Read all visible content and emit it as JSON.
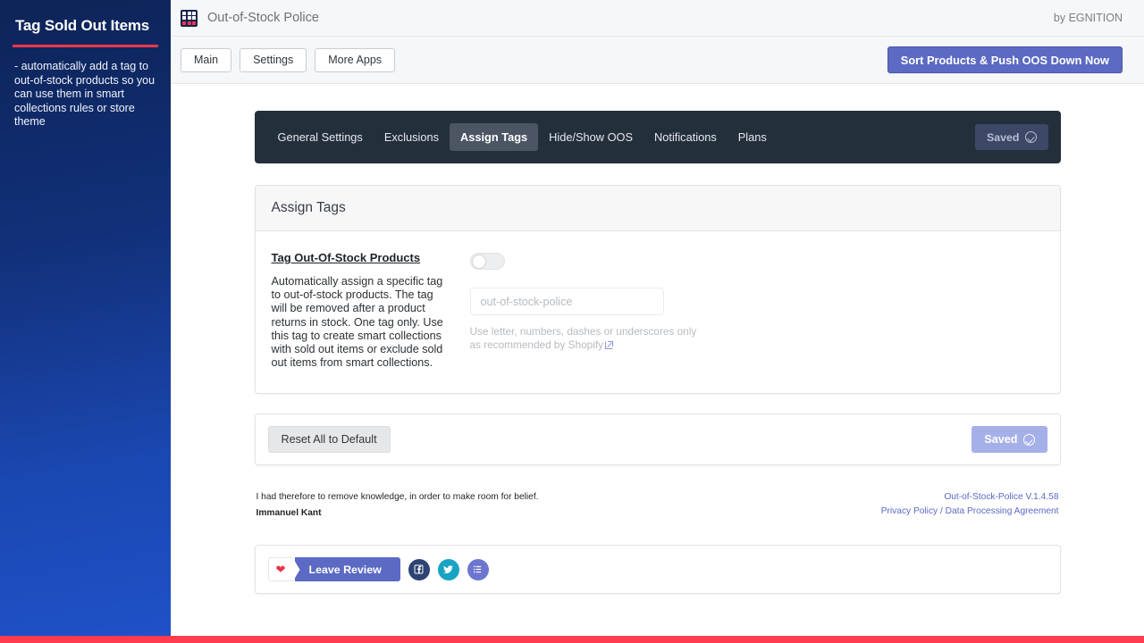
{
  "sidebar": {
    "title": "Tag Sold Out Items",
    "description": "- automatically add a tag to out-of-stock products so you can use them in smart collections rules or store theme",
    "accent_color": "#f9364b",
    "gradient_from": "#0d2457",
    "gradient_to": "#1f51c8"
  },
  "topbar": {
    "app_icon": "grid-icon",
    "app_title": "Out-of-Stock Police",
    "by_line": "by EGNITION"
  },
  "navbar": {
    "buttons": [
      {
        "label": "Main"
      },
      {
        "label": "Settings"
      },
      {
        "label": "More Apps"
      }
    ],
    "primary_button": "Sort Products & Push OOS Down Now",
    "primary_color": "#5c6ac4"
  },
  "tabs": {
    "items": [
      {
        "label": "General Settings",
        "active": false
      },
      {
        "label": "Exclusions",
        "active": false
      },
      {
        "label": "Assign Tags",
        "active": true
      },
      {
        "label": "Hide/Show OOS",
        "active": false
      },
      {
        "label": "Notifications",
        "active": false
      },
      {
        "label": "Plans",
        "active": false
      }
    ],
    "saved_label": "Saved",
    "bar_color": "#242f3c"
  },
  "card": {
    "title": "Assign Tags",
    "field_label": "Tag Out-Of-Stock Products",
    "field_description": "Automatically assign a specific tag to out-of-stock products. The tag will be removed after a product returns in stock. One tag only. Use this tag to create smart collections with sold out items or exclude sold out items from smart collections.",
    "toggle_state": "off",
    "tag_input_value": "",
    "tag_input_placeholder": "out-of-stock-police",
    "hint_line1": "Use letter, numbers, dashes or underscores only",
    "hint_line2": "as recommended by Shopify"
  },
  "reset_row": {
    "reset_label": "Reset All to Default",
    "saved_label": "Saved",
    "saved_color": "#a6b0e8"
  },
  "footer": {
    "quote": "I had therefore to remove knowledge, in order to make room for belief.",
    "author": "Immanuel Kant",
    "version": "Out-of-Stock-Police V.1.4.58",
    "privacy_policy": "Privacy Policy",
    "link_separator": " / ",
    "data_processing": "Data Processing Agreement",
    "link_color": "#5c6ac4"
  },
  "review_bar": {
    "heart_icon": "heart-icon",
    "review_label": "Leave Review",
    "socials": [
      {
        "name": "facebook-icon",
        "color": "#2d4373"
      },
      {
        "name": "twitter-icon",
        "color": "#18a3c4"
      },
      {
        "name": "list-icon",
        "color": "#6d76cf"
      }
    ]
  },
  "bottom_bar_color": "#ff3b4e"
}
